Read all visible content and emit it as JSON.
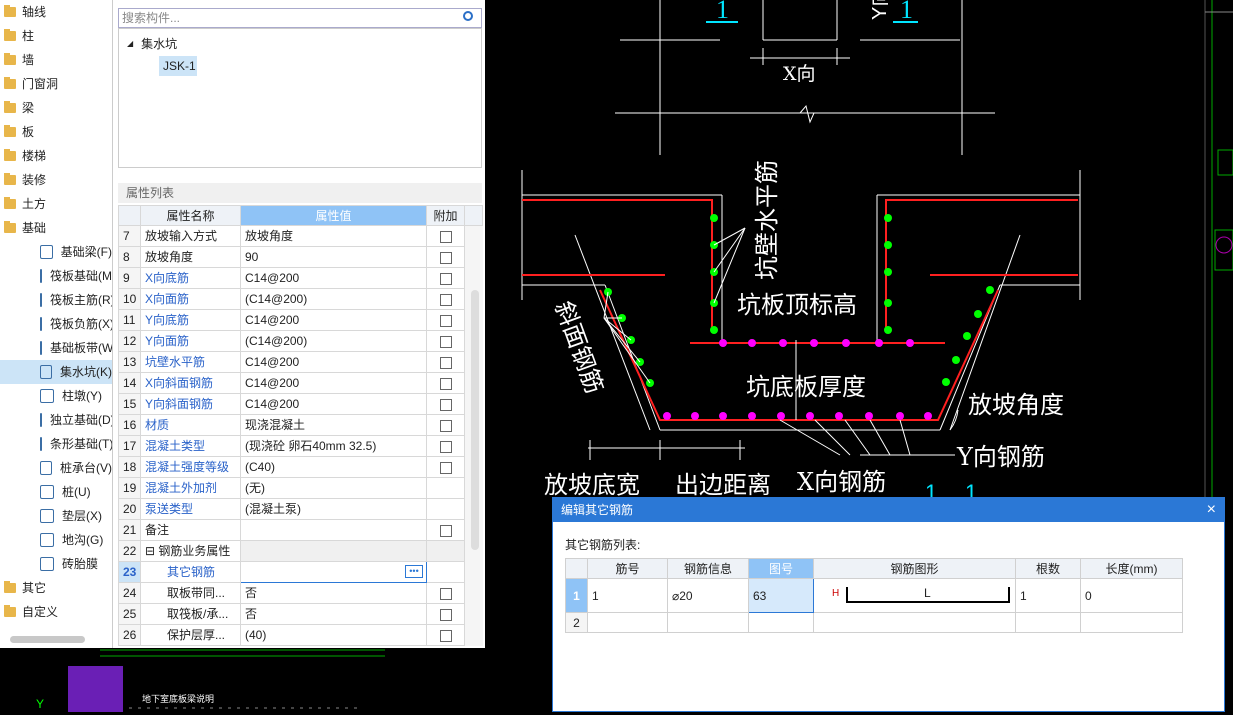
{
  "tree": {
    "top_items": [
      {
        "label": "轴线",
        "icon": "folder-icon"
      },
      {
        "label": "柱",
        "icon": "folder-icon"
      },
      {
        "label": "墙",
        "icon": "folder-icon"
      },
      {
        "label": "门窗洞",
        "icon": "folder-icon"
      },
      {
        "label": "梁",
        "icon": "folder-icon"
      },
      {
        "label": "板",
        "icon": "folder-icon"
      },
      {
        "label": "楼梯",
        "icon": "folder-icon"
      },
      {
        "label": "装修",
        "icon": "folder-icon"
      },
      {
        "label": "土方",
        "icon": "folder-icon"
      },
      {
        "label": "基础",
        "icon": "folder-open-icon"
      }
    ],
    "sub_items": [
      {
        "label": "基础梁(F)"
      },
      {
        "label": "筏板基础(M)"
      },
      {
        "label": "筏板主筋(R)"
      },
      {
        "label": "筏板负筋(X)"
      },
      {
        "label": "基础板带(W)"
      },
      {
        "label": "集水坑(K)"
      },
      {
        "label": "柱墩(Y)"
      },
      {
        "label": "独立基础(D)"
      },
      {
        "label": "条形基础(T)"
      },
      {
        "label": "桩承台(V)"
      },
      {
        "label": "桩(U)"
      },
      {
        "label": "垫层(X)"
      },
      {
        "label": "地沟(G)"
      },
      {
        "label": "砖胎膜"
      }
    ],
    "bottom_items": [
      {
        "label": "其它"
      },
      {
        "label": "自定义"
      }
    ]
  },
  "component": {
    "search_placeholder": "搜索构件...",
    "group": "集水坑",
    "item": "JSK-1"
  },
  "properties": {
    "title": "属性列表",
    "headers": [
      "属性名称",
      "属性值",
      "附加"
    ],
    "rows": [
      {
        "n": "7",
        "name": "放坡输入方式",
        "value": "放坡角度",
        "blue": false,
        "cb": true
      },
      {
        "n": "8",
        "name": "放坡角度",
        "value": "90",
        "blue": false,
        "cb": true
      },
      {
        "n": "9",
        "name": "X向底筋",
        "value": "C14@200",
        "blue": true,
        "cb": true
      },
      {
        "n": "10",
        "name": "X向面筋",
        "value": "(C14@200)",
        "blue": true,
        "cb": true
      },
      {
        "n": "11",
        "name": "Y向底筋",
        "value": "C14@200",
        "blue": true,
        "cb": true
      },
      {
        "n": "12",
        "name": "Y向面筋",
        "value": "(C14@200)",
        "blue": true,
        "cb": true
      },
      {
        "n": "13",
        "name": "坑壁水平筋",
        "value": "C14@200",
        "blue": true,
        "cb": true
      },
      {
        "n": "14",
        "name": "X向斜面钢筋",
        "value": "C14@200",
        "blue": true,
        "cb": true
      },
      {
        "n": "15",
        "name": "Y向斜面钢筋",
        "value": "C14@200",
        "blue": true,
        "cb": true
      },
      {
        "n": "16",
        "name": "材质",
        "value": "现浇混凝土",
        "blue": true,
        "cb": true
      },
      {
        "n": "17",
        "name": "混凝土类型",
        "value": "(现浇砼 卵石40mm 32.5)",
        "blue": true,
        "cb": true
      },
      {
        "n": "18",
        "name": "混凝土强度等级",
        "value": "(C40)",
        "blue": true,
        "cb": true
      },
      {
        "n": "19",
        "name": "混凝土外加剂",
        "value": "(无)",
        "blue": true,
        "cb": false
      },
      {
        "n": "20",
        "name": "泵送类型",
        "value": "(混凝土泵)",
        "blue": true,
        "cb": false
      },
      {
        "n": "21",
        "name": "备注",
        "value": "",
        "blue": false,
        "cb": true
      },
      {
        "n": "22",
        "name": "⊟ 钢筋业务属性",
        "value": "",
        "blue": false,
        "cb": false
      },
      {
        "n": "23",
        "name": "其它钢筋",
        "value": "",
        "blue": true,
        "cb": false
      },
      {
        "n": "24",
        "name": "取板带同...",
        "value": "否",
        "blue": false,
        "cb": true
      },
      {
        "n": "25",
        "name": "取筏板/承...",
        "value": "否",
        "blue": false,
        "cb": true
      },
      {
        "n": "26",
        "name": "保护层厚...",
        "value": "(40)",
        "blue": false,
        "cb": true
      }
    ]
  },
  "cad": {
    "labels": [
      "X向",
      "坑壁水平筋",
      "坑板顶标高",
      "斜面钢筋",
      "坑底板厚度",
      "放坡角度",
      "Y向钢筋",
      "放坡底宽",
      "出边距离",
      "X向钢筋"
    ],
    "small_text": "地下室底板梁说明"
  },
  "dialog": {
    "title": "编辑其它钢筋",
    "list_label": "其它钢筋列表:",
    "headers": [
      "",
      "筋号",
      "钢筋信息",
      "图号",
      "钢筋图形",
      "根数",
      "长度(mm)"
    ],
    "rows": [
      {
        "n": "1",
        "bar": "1",
        "info": "⌀20",
        "fig": "63",
        "shape_label": "L",
        "shape_h": "H",
        "count": "1",
        "length": "0"
      },
      {
        "n": "2",
        "bar": "",
        "info": "",
        "fig": "",
        "shape_label": "",
        "shape_h": "",
        "count": "",
        "length": ""
      }
    ]
  },
  "colors": {
    "accent": "#2b78d6",
    "rebar_red": "#ff2020",
    "green_dot": "#00ff00",
    "magenta_dot": "#ff00ff"
  }
}
